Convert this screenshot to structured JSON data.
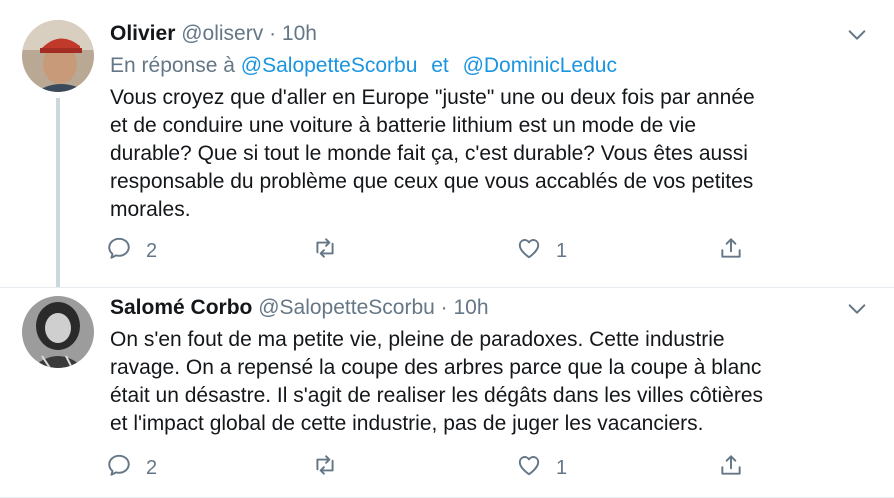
{
  "tweets": [
    {
      "name": "Olivier",
      "handle": "@oliserv",
      "separator": "·",
      "time": "10h",
      "reply_prefix": "En réponse à",
      "reply_to_1": "@SalopetteScorbu",
      "reply_joiner": "et",
      "reply_to_2": "@DominicLeduc",
      "text_lines": [
        "Vous croyez que d'aller en Europe \"juste\" une ou deux fois par année",
        "et de conduire une voiture à batterie lithium est un mode de vie",
        "durable? Que si tout le monde fait ça, c'est durable? Vous êtes aussi",
        "responsable du problème que ceux que vous accablés de vos petites",
        "morales."
      ],
      "reply_count": "2",
      "retweet_count": "",
      "like_count": "1",
      "icons": [
        "reply-icon",
        "retweet-icon",
        "like-icon",
        "share-icon",
        "chevron-down-icon"
      ]
    },
    {
      "name": "Salomé Corbo",
      "handle": "@SalopetteScorbu",
      "separator": "·",
      "time": "10h",
      "text_lines": [
        "On s'en fout de ma petite vie, pleine de paradoxes. Cette industrie",
        "ravage. On a repensé la coupe des arbres parce que la coupe à blanc",
        "était un désastre. Il s'agit de realiser les dégâts dans les villes côtières",
        "et l'impact global de cette industrie, pas de juger les vacanciers."
      ],
      "reply_count": "2",
      "retweet_count": "",
      "like_count": "1",
      "icons": [
        "reply-icon",
        "retweet-icon",
        "like-icon",
        "share-icon",
        "chevron-down-icon"
      ]
    }
  ],
  "colors": {
    "text": "#14171a",
    "muted": "#657786",
    "link": "#1b95e0",
    "thread_line": "#ccd6dd"
  }
}
